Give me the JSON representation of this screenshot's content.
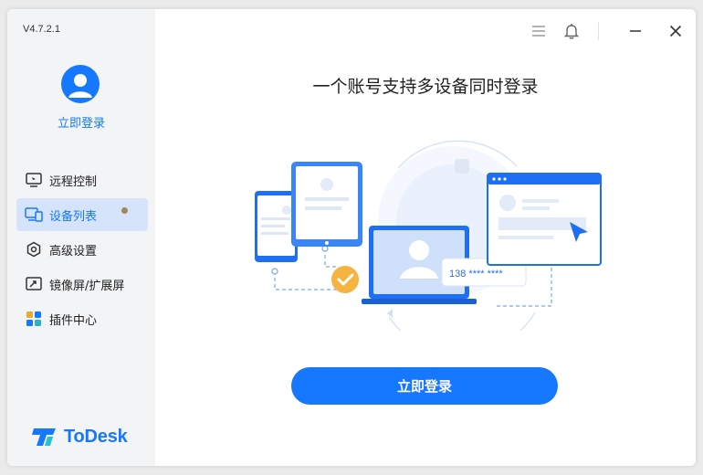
{
  "app": {
    "version": "V4.7.2.1",
    "brand": "ToDesk",
    "accent": "#1677ff"
  },
  "sidebar": {
    "login_label": "立即登录",
    "items": [
      {
        "label": "远程控制",
        "icon": "monitor-icon",
        "active": false
      },
      {
        "label": "设备列表",
        "icon": "devices-icon",
        "active": true
      },
      {
        "label": "高级设置",
        "icon": "hexagon-settings-icon",
        "active": false
      },
      {
        "label": "镜像屏/扩展屏",
        "icon": "mirror-screen-icon",
        "active": false
      },
      {
        "label": "插件中心",
        "icon": "plugin-icon",
        "active": false
      }
    ]
  },
  "main": {
    "headline": "一个账号支持多设备同时登录",
    "illustration_caption": "138 **** ****",
    "login_button": "立即登录"
  }
}
